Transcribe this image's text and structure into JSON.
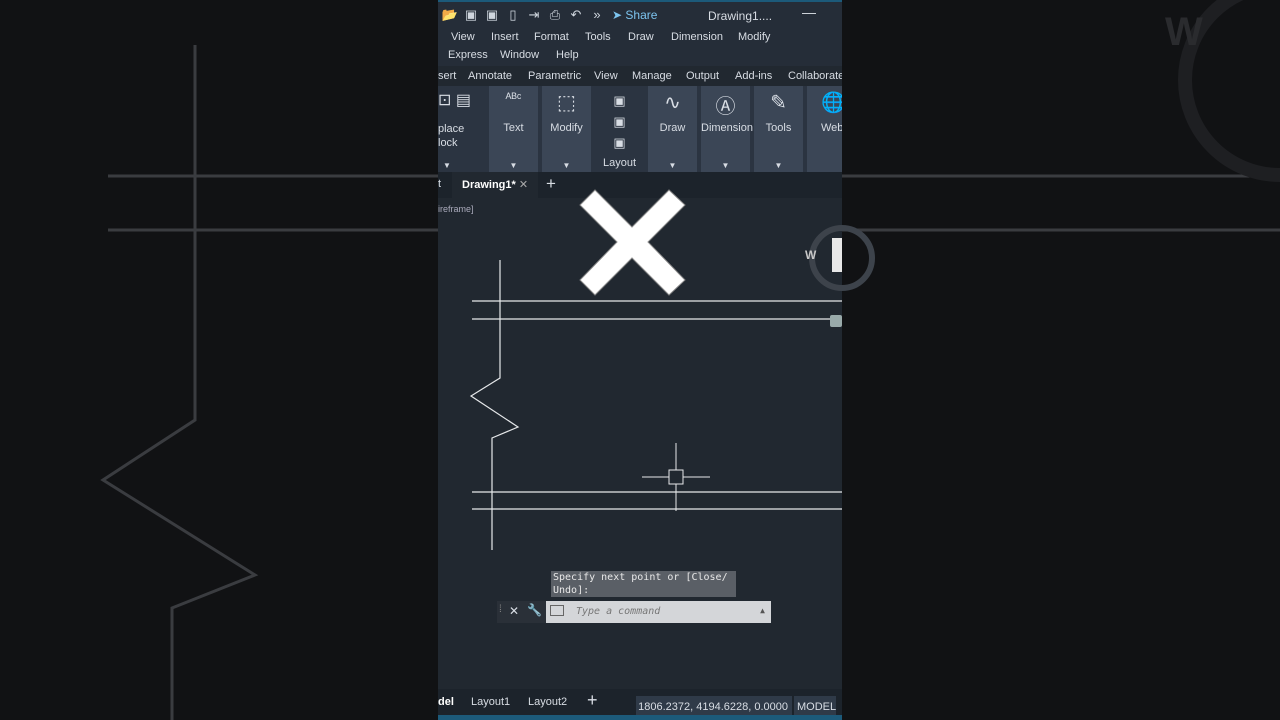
{
  "quick_access": {
    "share": "Share",
    "title": "Drawing1...."
  },
  "menu": [
    "View",
    "Insert",
    "Format",
    "Tools",
    "Draw",
    "Dimension",
    "Modify",
    "Express",
    "Window",
    "Help"
  ],
  "ribbon_tabs": [
    "sert",
    "Annotate",
    "Parametric",
    "View",
    "Manage",
    "Output",
    "Add-ins",
    "Collaborate"
  ],
  "ribbon_panels": {
    "block": "place\nlock",
    "text": "Text",
    "modify": "Modify",
    "layout": "Layout",
    "draw": "Draw",
    "dimension": "Dimension",
    "tools": "Tools",
    "web": "Web"
  },
  "doc_tabs": {
    "start": "t",
    "active": "Drawing1*",
    "close": "✕",
    "add": "+"
  },
  "viewport_label": "ireframe]",
  "viewcube_letter": "W",
  "command": {
    "prompt": "Specify next point or [Close/ Undo]:",
    "placeholder": "Type a command"
  },
  "status": {
    "tabs": [
      "del",
      "Layout1",
      "Layout2"
    ],
    "add": "+",
    "coords": "1806.2372, 4194.6228, 0.0000",
    "space": "MODEL"
  }
}
